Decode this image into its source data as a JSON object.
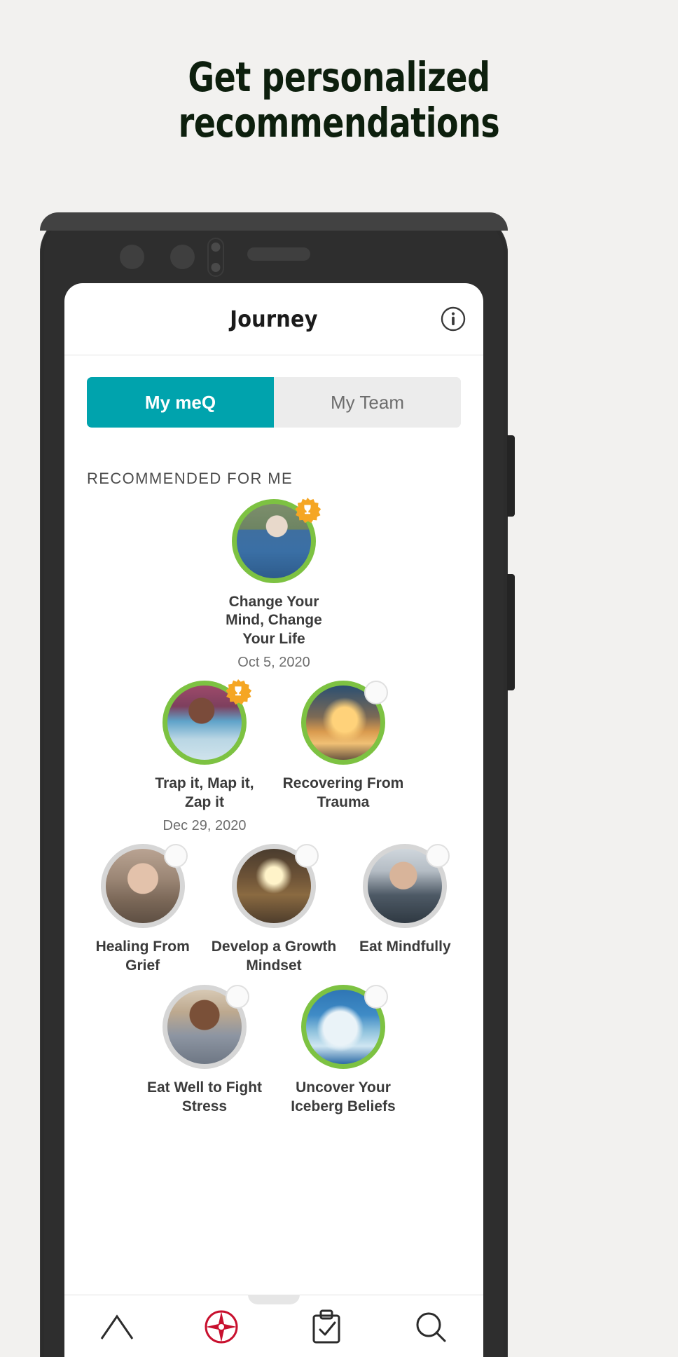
{
  "headline": {
    "line1": "Get personalized",
    "line2": "recommendations"
  },
  "colors": {
    "page_background": "#f2f1ef",
    "headline_text": "#0d1f0d",
    "accent_teal": "#00a3ad",
    "ring_complete_green": "#7dc242",
    "ring_incomplete_grey": "#d6d6d6",
    "badge_gold": "#f5a623",
    "nav_active_red": "#c8102e",
    "phone_bezel": "#2c2c2c"
  },
  "app": {
    "header": {
      "title": "Journey",
      "info_icon": "info-circle-icon"
    },
    "tabs": [
      {
        "label": "My meQ",
        "active": true
      },
      {
        "label": "My Team",
        "active": false
      }
    ],
    "section": {
      "title": "RECOMMENDED FOR ME"
    },
    "rows": [
      {
        "cards": [
          {
            "title": "Change Your Mind, Change Your Life",
            "date": "Oct 5, 2020",
            "ring": "green",
            "badge": "trophy-badge-icon",
            "photo": "ph-a"
          }
        ]
      },
      {
        "cards": [
          {
            "title": "Trap it, Map it, Zap it",
            "date": "Dec 29, 2020",
            "ring": "green",
            "badge": "trophy-badge-icon",
            "photo": "ph-b"
          },
          {
            "title": "Recovering From Trauma",
            "date": "",
            "ring": "green",
            "badge": "empty-badge-icon",
            "photo": "ph-c"
          }
        ]
      },
      {
        "cards": [
          {
            "title": "Healing From Grief",
            "date": "",
            "ring": "grey",
            "badge": "empty-badge-icon",
            "photo": "ph-d"
          },
          {
            "title": "Develop a Growth Mindset",
            "date": "",
            "ring": "grey",
            "badge": "empty-badge-icon",
            "photo": "ph-e"
          },
          {
            "title": "Eat Mindfully",
            "date": "",
            "ring": "grey",
            "badge": "empty-badge-icon",
            "photo": "ph-f"
          }
        ]
      },
      {
        "cards": [
          {
            "title": "Eat Well to Fight Stress",
            "date": "",
            "ring": "grey",
            "badge": "empty-badge-icon",
            "photo": "ph-g"
          },
          {
            "title": "Uncover Your Iceberg Beliefs",
            "date": "",
            "ring": "green",
            "badge": "empty-badge-icon",
            "photo": "ph-h"
          }
        ]
      }
    ],
    "bottom_nav": [
      {
        "icon": "home-icon",
        "active": false
      },
      {
        "icon": "compass-icon",
        "active": true
      },
      {
        "icon": "clipboard-check-icon",
        "active": false
      },
      {
        "icon": "search-icon",
        "active": false
      }
    ]
  },
  "phone": {
    "sensors": [
      "camera-lens-1",
      "camera-lens-2",
      "proximity-sensor-pair",
      "earpiece-speaker"
    ],
    "side_buttons": [
      "volume-button",
      "power-button"
    ]
  }
}
